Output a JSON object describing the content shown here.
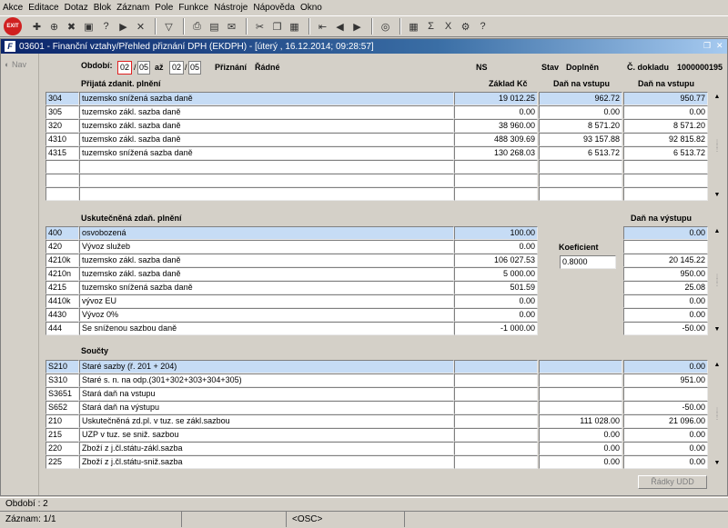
{
  "menu": [
    "Akce",
    "Editace",
    "Dotaz",
    "Blok",
    "Záznam",
    "Pole",
    "Funkce",
    "Nástroje",
    "Nápověda",
    "Okno"
  ],
  "toolbar_icons": [
    "exit-icon",
    "new-record-icon",
    "insert-icon",
    "delete-icon",
    "save-icon",
    "query-icon",
    "execute-query-icon",
    "cancel-query-icon",
    "filter-icon",
    "print-icon",
    "print-preview-icon",
    "mail-icon",
    "cut-icon",
    "copy-icon",
    "paste-icon",
    "first-record-icon",
    "previous-record-icon",
    "next-record-icon",
    "web-icon",
    "calculator-icon",
    "sum-icon",
    "excel-icon",
    "settings-icon",
    "help-icon"
  ],
  "window": {
    "title": "03601 - Finanční vztahy/Přehled přiznání DPH (EKDPH) - [úterý , 16.12.2014; 09:28:57]",
    "logo": "F",
    "nav_label": "Nav"
  },
  "header": {
    "obdobi_label": "Období:",
    "from_month": "02",
    "from_year": "05",
    "az_label": "až",
    "to_month": "02",
    "to_year": "05",
    "priznani_label": "Přiznání",
    "priznani_value": "Řádné",
    "ns_label": "NS",
    "stav_label": "Stav",
    "stav_value": "Doplněn",
    "doklad_label": "Č. dokladu",
    "doklad_value": "1000000195"
  },
  "section1": {
    "title": "Přijatá zdanit. plnění",
    "col_base": "Základ Kč",
    "col_vstup": "Daň na vstupu",
    "col_vstup2": "Daň na vstupu",
    "rows": [
      {
        "code": "304",
        "desc": "tuzemsko snížená sazba daně",
        "base": "19 012.25",
        "tax1": "962.72",
        "tax2": "950.77"
      },
      {
        "code": "305",
        "desc": "tuzemsko zákl. sazba daně",
        "base": "0.00",
        "tax1": "0.00",
        "tax2": "0.00"
      },
      {
        "code": "320",
        "desc": "tuzemsko zákl. sazba daně",
        "base": "38 960.00",
        "tax1": "8 571.20",
        "tax2": "8 571.20"
      },
      {
        "code": "4310",
        "desc": "tuzemsko zákl. sazba daně",
        "base": "488 309.69",
        "tax1": "93 157.88",
        "tax2": "92 815.82"
      },
      {
        "code": "4315",
        "desc": "tuzemsko snížená sazba daně",
        "base": "130 268.03",
        "tax1": "6 513.72",
        "tax2": "6 513.72"
      },
      {
        "code": "",
        "desc": "",
        "base": "",
        "tax1": "",
        "tax2": ""
      },
      {
        "code": "",
        "desc": "",
        "base": "",
        "tax1": "",
        "tax2": ""
      },
      {
        "code": "",
        "desc": "",
        "base": "",
        "tax1": "",
        "tax2": ""
      }
    ]
  },
  "section2": {
    "title": "Uskutečněná zdaň. plnění",
    "col_vystup": "Daň na výstupu",
    "koeficient_label": "Koeficient",
    "koeficient_value": "0.8000",
    "rows": [
      {
        "code": "400",
        "desc": "osvobozená",
        "base": "100.00",
        "tax": "0.00"
      },
      {
        "code": "420",
        "desc": "Vývoz služeb",
        "base": "0.00",
        "tax": ""
      },
      {
        "code": "4210k",
        "desc": "tuzemsko zákl. sazba daně",
        "base": "106 027.53",
        "tax": "20 145.22"
      },
      {
        "code": "4210n",
        "desc": "tuzemsko zákl. sazba daně",
        "base": "5 000.00",
        "tax": "950.00"
      },
      {
        "code": "4215",
        "desc": "tuzemsko snížená sazba daně",
        "base": "501.59",
        "tax": "25.08"
      },
      {
        "code": "4410k",
        "desc": "vývoz EU",
        "base": "0.00",
        "tax": "0.00"
      },
      {
        "code": "4430",
        "desc": "Vývoz 0%",
        "base": "0.00",
        "tax": "0.00"
      },
      {
        "code": "444",
        "desc": "Se sníženou sazbou daně",
        "base": "-1 000.00",
        "tax": "-50.00"
      }
    ]
  },
  "section3": {
    "title": "Součty",
    "rows": [
      {
        "code": "S210",
        "desc": "Staré sazby (ř. 201 + 204)",
        "base": "",
        "mid": "",
        "tax": "0.00"
      },
      {
        "code": "S310",
        "desc": "Staré s. n. na odp.(301+302+303+304+305)",
        "base": "",
        "mid": "",
        "tax": "951.00"
      },
      {
        "code": "S3651",
        "desc": "Stará daň na vstupu",
        "base": "",
        "mid": "",
        "tax": ""
      },
      {
        "code": "S652",
        "desc": "Stará daň na výstupu",
        "base": "",
        "mid": "",
        "tax": "-50.00"
      },
      {
        "code": "210",
        "desc": "Uskutečněná zd.pl. v tuz. se zákl.sazbou",
        "base": "",
        "mid": "111 028.00",
        "tax": "21 096.00"
      },
      {
        "code": "215",
        "desc": "UZP v tuz. se sniž. sazbou",
        "base": "",
        "mid": "0.00",
        "tax": "0.00"
      },
      {
        "code": "220",
        "desc": "Zboží z j.čl.státu-zákl.sazba",
        "base": "",
        "mid": "0.00",
        "tax": "0.00"
      },
      {
        "code": "225",
        "desc": "Zboží z j.čl.státu-sniž.sazba",
        "base": "",
        "mid": "0.00",
        "tax": "0.00"
      }
    ],
    "button_label": "Řádky UDD"
  },
  "status": {
    "line1": "Období : 2",
    "record": "Záznam: 1/1",
    "osc": "<OSC>"
  }
}
